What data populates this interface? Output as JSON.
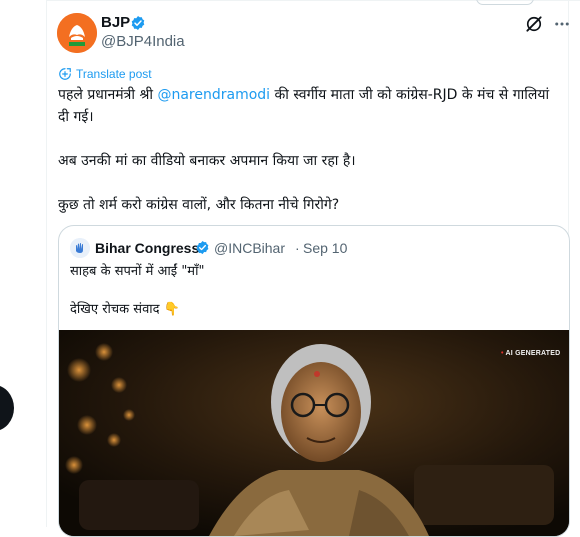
{
  "tweet": {
    "author_name": "BJP",
    "author_handle": "@BJP4India",
    "translate_label": "Translate post",
    "text_before_mention": "पहले प्रधानमंत्री श्री ",
    "mention": "@narendramodi",
    "text_after_mention": " की स्वर्गीय माता जी को कांग्रेस-RJD के मंच से गालियां दी गई।",
    "paragraph_2": "अब उनकी मां का वीडियो बनाकर अपमान किया जा रहा है।",
    "paragraph_3": "कुछ तो शर्म करो कांग्रेस वालों, और कितना नीचे गिरोगे?"
  },
  "quote": {
    "author_name": "Bihar Congress",
    "author_handle": "@INCBihar",
    "separator": "·",
    "date": "Sep 10",
    "line_1": "साहब के सपनों में आईं \"माँ\"",
    "line_2": "देखिए रोचक संवाद",
    "emoji": "👇",
    "media_badge_dot": "•",
    "media_badge_text": "AI GENERATED"
  },
  "icons": {
    "verified": "verified-badge-icon",
    "grok": "grok-icon",
    "more": "more-options-icon",
    "translate": "translate-icon"
  },
  "colors": {
    "accent": "#1d9bf0",
    "text": "#0f1419",
    "muted": "#536471",
    "bjp_orange": "#f36f21"
  }
}
